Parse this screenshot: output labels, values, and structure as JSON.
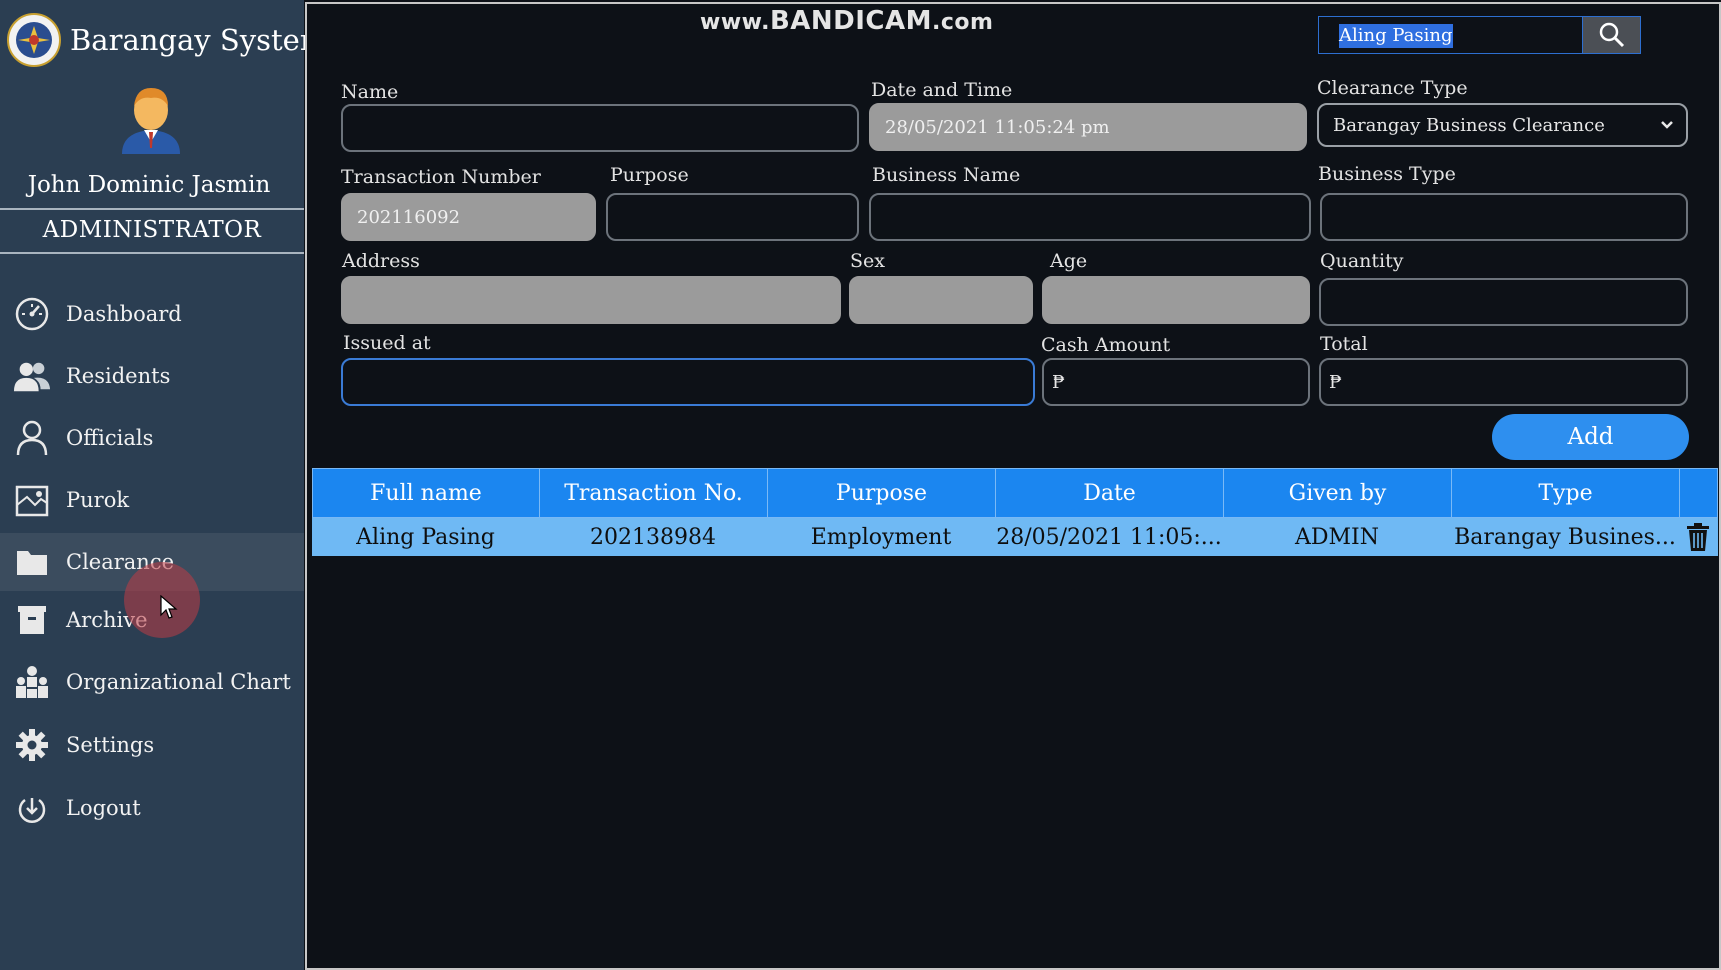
{
  "brand": {
    "title": "Barangay System",
    "logo_icon": "barangay-seal-icon"
  },
  "user": {
    "name": "John Dominic Jasmin",
    "role": "ADMINISTRATOR",
    "avatar_icon": "user-avatar-icon"
  },
  "sidebar": {
    "items": [
      {
        "label": "Dashboard",
        "icon": "gauge-icon",
        "active": false
      },
      {
        "label": "Residents",
        "icon": "people-icon",
        "active": false
      },
      {
        "label": "Officials",
        "icon": "person-icon",
        "active": false
      },
      {
        "label": "Purok",
        "icon": "map-icon",
        "active": false
      },
      {
        "label": "Clearance",
        "icon": "folder-icon",
        "active": true
      },
      {
        "label": "Archive",
        "icon": "archive-box-icon",
        "active": false
      },
      {
        "label": "Organizational Chart",
        "icon": "org-chart-icon",
        "active": false
      },
      {
        "label": "Settings",
        "icon": "gear-icon",
        "active": false
      },
      {
        "label": "Logout",
        "icon": "power-icon",
        "active": false
      }
    ]
  },
  "watermark": {
    "prefix": "www.",
    "brand": "BANDICAM",
    "suffix": ".com"
  },
  "search": {
    "value": "Aling Pasing"
  },
  "form": {
    "name": {
      "label": "Name",
      "value": ""
    },
    "date_time": {
      "label": "Date and Time",
      "value": "28/05/2021 11:05:24 pm"
    },
    "clearance_type": {
      "label": "Clearance Type",
      "value": "Barangay Business Clearance"
    },
    "transaction_number": {
      "label": "Transaction Number",
      "value": "202116092"
    },
    "purpose": {
      "label": "Purpose",
      "value": ""
    },
    "business_name": {
      "label": "Business Name",
      "value": ""
    },
    "business_type": {
      "label": "Business Type",
      "value": ""
    },
    "address": {
      "label": "Address",
      "value": ""
    },
    "sex": {
      "label": "Sex",
      "value": ""
    },
    "age": {
      "label": "Age",
      "value": ""
    },
    "quantity": {
      "label": "Quantity",
      "value": ""
    },
    "issued_at": {
      "label": "Issued at",
      "value": ""
    },
    "cash_amount": {
      "label": "Cash Amount",
      "value": "₱"
    },
    "total": {
      "label": "Total",
      "value": "₱"
    },
    "add_label": "Add"
  },
  "table": {
    "columns": [
      "Full name",
      "Transaction No.",
      "Purpose",
      "Date",
      "Given by",
      "Type"
    ],
    "rows": [
      [
        "Aling Pasing",
        "202138984",
        "Employment",
        "28/05/2021 11:05:...",
        "ADMIN",
        "Barangay Busines..."
      ]
    ],
    "delete_icon": "trash-icon"
  },
  "colors": {
    "sidebar_bg": "#2b3e52",
    "main_bg": "#0d1117",
    "accent": "#2e8fef",
    "header_bg": "#1b86f0",
    "row_selected": "#6fb9f4"
  }
}
